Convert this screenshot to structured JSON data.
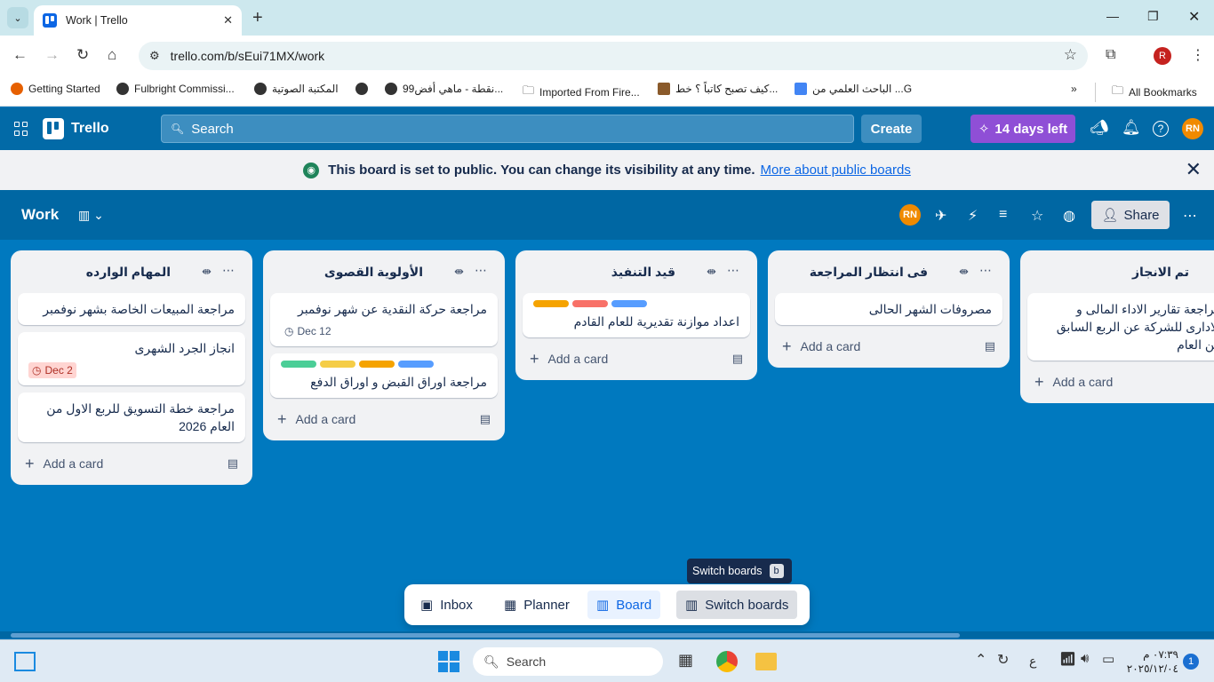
{
  "browser": {
    "tab_title": "Work | Trello",
    "url": "trello.com/b/sEui71MX/work",
    "profile_initial": "R",
    "bookmarks": [
      "Getting Started",
      "Fulbright Commissi...",
      "المكتبة الصوتية",
      "99نقطة - ماهي أفض...",
      "Imported From Fire...",
      "كيف تصبح كاتباً ؟ خط...",
      "الباحث العلمي من ...G"
    ],
    "all_bookmarks": "All Bookmarks"
  },
  "trello": {
    "logo": "Trello",
    "search_placeholder": "Search",
    "create": "Create",
    "trial": "14 days left",
    "user_initials": "RN"
  },
  "banner": {
    "message": "This board is set to public. You can change its visibility at any time.",
    "link": "More about public boards"
  },
  "board": {
    "title": "Work",
    "share": "Share"
  },
  "lists": [
    {
      "title": "المهام الوارده",
      "cards": [
        {
          "title": "مراجعة المبيعات الخاصة بشهر نوفمبر"
        },
        {
          "title": "انجاز الجرد الشهرى",
          "due": "Dec 2"
        },
        {
          "title": "مراجعة خطة التسويق للربع الاول من العام 2026"
        }
      ],
      "add": "Add a card"
    },
    {
      "title": "الأولوية القصوى",
      "cards": [
        {
          "title": "مراجعة حركة النقدية عن شهر نوفمبر",
          "date": "Dec 12"
        },
        {
          "title": "مراجعة اوراق القبض و اوراق الدفع"
        }
      ],
      "add": "Add a card"
    },
    {
      "title": "قيد التنفيذ",
      "cards": [
        {
          "title": "اعداد موازنة تقديرية للعام القادم"
        }
      ],
      "add": "Add a card"
    },
    {
      "title": "فى انتظار المراجعة",
      "cards": [
        {
          "title": "مصروفات الشهر الحالى"
        }
      ],
      "add": "Add a card"
    },
    {
      "title": "تم الانجاز",
      "cards": [
        {
          "title": "مراجعة تقارير الاداء المالى و الادارى للشركة عن الربع السابق من العام"
        }
      ],
      "add": "Add a card"
    }
  ],
  "label_colors": {
    "green": "#4bce97",
    "yellow": "#f5cd47",
    "orange": "#fea362",
    "red": "#f87168",
    "blue": "#579dff",
    "dark_orange": "#f5a300"
  },
  "switcher": {
    "tooltip": "Switch boards",
    "tooltip_key": "b",
    "inbox": "Inbox",
    "planner": "Planner",
    "board": "Board",
    "switch": "Switch boards"
  },
  "taskbar": {
    "search": "Search",
    "lang": "ع",
    "time": "٠٧:٣٩ م",
    "date": "٢٠٢٥/١٢/٠٤",
    "notifications": "1"
  }
}
